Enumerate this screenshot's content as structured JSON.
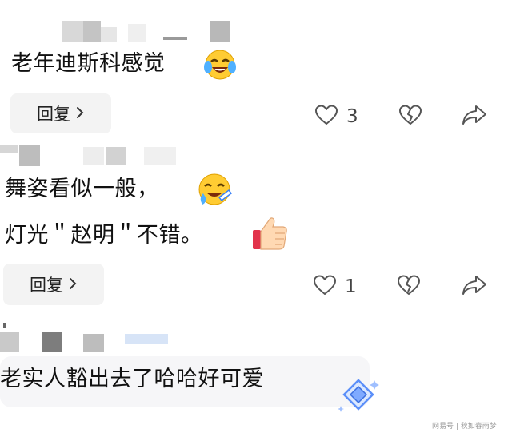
{
  "comments": [
    {
      "text": "老年迪斯科感觉",
      "reply_label": "回复",
      "like_count": "3"
    },
    {
      "line1": "舞姿看似一般，",
      "line2": "灯光＂赵明＂不错。",
      "reply_label": "回复",
      "like_count": "1"
    },
    {
      "text": "老实人豁出去了哈哈好可爱"
    }
  ],
  "icons": {
    "like": "heart-icon",
    "dislike": "broken-heart-icon",
    "share": "share-icon",
    "reply_chevron": "chevron-right-icon",
    "emoji_laugh_cry": "laughing-crying-emoji-icon",
    "emoji_sweat": "sweat-smile-emoji-icon",
    "emoji_thumbs": "thumbs-up-emoji-icon",
    "badge": "diamond-badge-icon"
  },
  "watermark": "网易号 | 秋如春雨梦",
  "colors": {
    "text": "#111111",
    "button_bg": "#f3f3f3",
    "icon_stroke": "#555555",
    "bubble_bg": "#f6f6f8",
    "badge_blue": "#5b8ff9"
  }
}
